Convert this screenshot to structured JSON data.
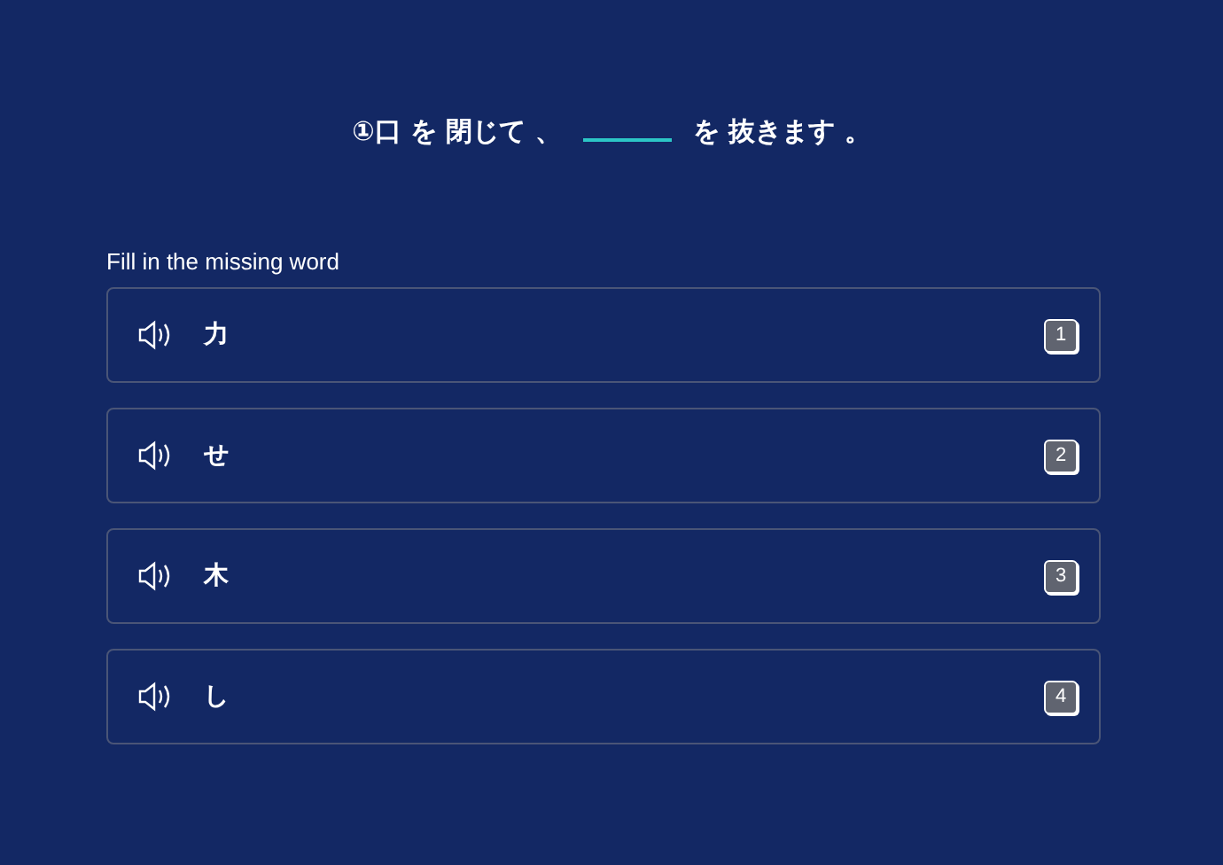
{
  "question": {
    "before": "①口 を 閉じて 、",
    "after": "を 抜きます 。"
  },
  "prompt": "Fill in the missing word",
  "options": [
    {
      "text": "力",
      "key": "1"
    },
    {
      "text": "せ",
      "key": "2"
    },
    {
      "text": "木",
      "key": "3"
    },
    {
      "text": "し",
      "key": "4"
    }
  ]
}
